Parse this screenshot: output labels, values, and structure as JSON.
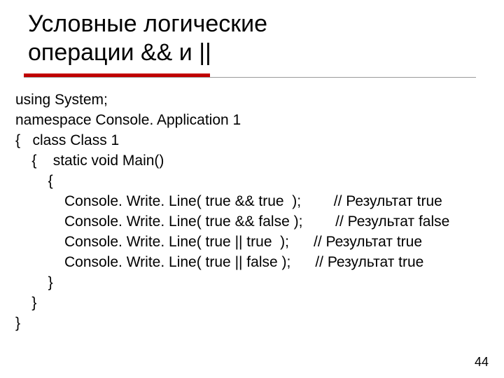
{
  "title_line1": "Условные логические",
  "title_line2": "операции && и ||",
  "code": {
    "l1": "using System;",
    "l2": "namespace Console. Application 1",
    "l3": "{   class Class 1",
    "l4": "    {    static void Main()",
    "l5": "        {",
    "l6": "            Console. Write. Line( true && true  );        // Результат true",
    "l7": "            Console. Write. Line( true && false );        // Результат false",
    "l8": "            Console. Write. Line( true || true  );      // Результат true",
    "l9": "            Console. Write. Line( true || false );      // Результат true",
    "l10": "        }",
    "l11": "    }",
    "l12": "}"
  },
  "page_number": "44"
}
